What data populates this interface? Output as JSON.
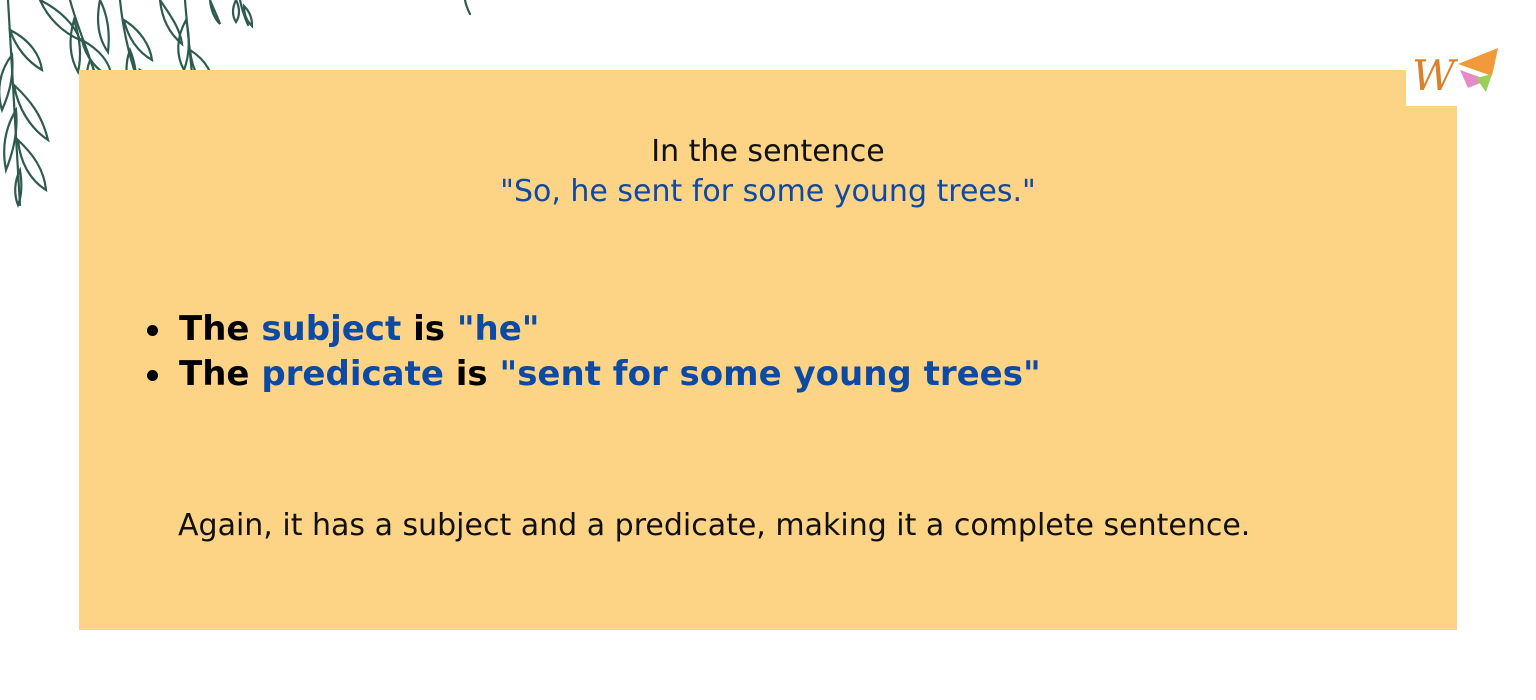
{
  "intro": {
    "line1": "In the sentence",
    "line2": "\"So, he sent for some young trees.\""
  },
  "bullets": [
    {
      "lead": "The",
      "term": "subject",
      "verb": "is",
      "value": "\"he\""
    },
    {
      "lead": "The",
      "term": "predicate",
      "verb": "is",
      "value": "\"sent for some young trees\""
    }
  ],
  "conclusion": "Again, it has a subject and a predicate, making it a complete sentence.",
  "logo": {
    "letter": "W"
  },
  "colors": {
    "card_background": "#fdd386",
    "accent_blue": "#0d4aa3",
    "leaf_stroke": "#2f5a4f"
  }
}
